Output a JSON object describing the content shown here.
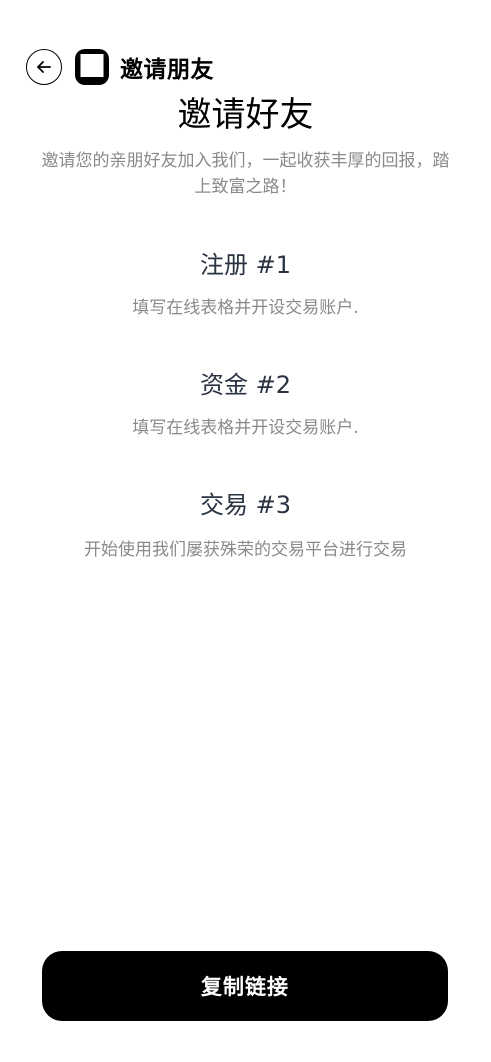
{
  "header": {
    "title": "邀请朋友"
  },
  "page": {
    "title": "邀请好友",
    "intro": "邀请您的亲朋好友加入我们，一起收获丰厚的回报，踏上致富之路！"
  },
  "steps": [
    {
      "title": "注册 #1",
      "description": "填写在线表格并开设交易账户."
    },
    {
      "title": "资金 #2",
      "description": "填写在线表格并开设交易账户."
    },
    {
      "title": "交易 #3",
      "description": "开始使用我们屡获殊荣的交易平台进行交易"
    }
  ],
  "actions": {
    "copy_link_label": "复制链接"
  },
  "icons": {
    "back": "arrow-left-icon",
    "logo": "square-logo-icon"
  }
}
